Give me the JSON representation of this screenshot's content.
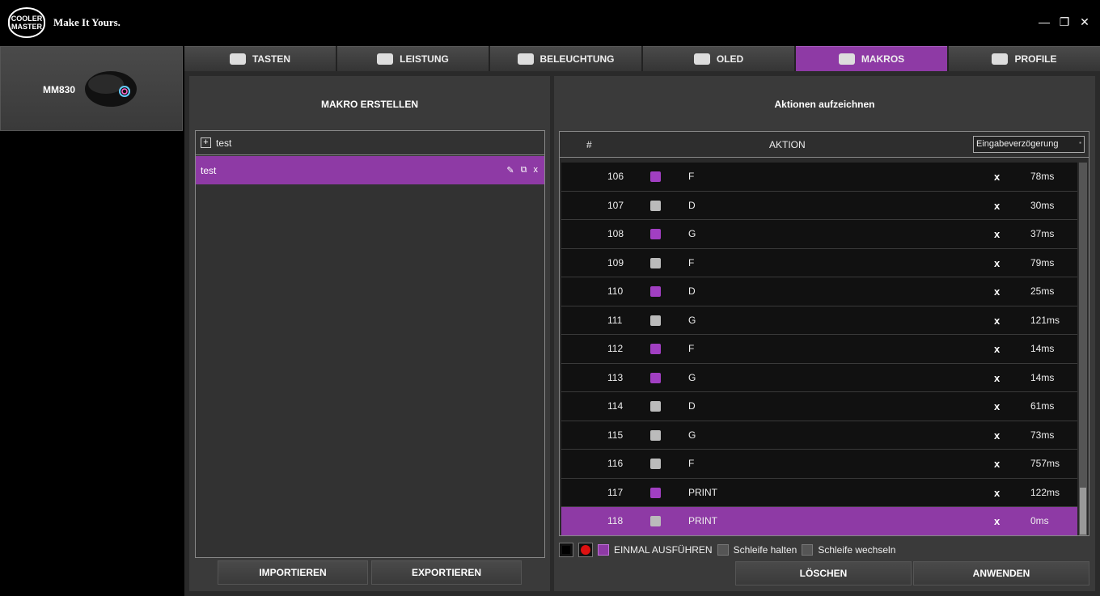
{
  "header": {
    "logo": "COOLER MASTER",
    "tagline": "Make It Yours."
  },
  "window": {
    "minimize": "—",
    "maximize": "❐",
    "close": "✕"
  },
  "device": {
    "name": "MM830"
  },
  "tabs": [
    {
      "label": "TASTEN",
      "icon": "keyboard-icon"
    },
    {
      "label": "LEISTUNG",
      "icon": "speedometer-icon"
    },
    {
      "label": "BELEUCHTUNG",
      "icon": "lightbulb-icon"
    },
    {
      "label": "OLED",
      "icon": "oled-icon"
    },
    {
      "label": "MAKROS",
      "icon": "macro-icon",
      "active": true
    },
    {
      "label": "PROFILE",
      "icon": "profile-icon"
    }
  ],
  "left": {
    "title": "MAKRO ERSTELLEN",
    "group": "test",
    "macro": "test",
    "actions": {
      "edit": "✎",
      "copy": "⧉",
      "delete": "x"
    },
    "import": "IMPORTIEREN",
    "export": "EXPORTIEREN"
  },
  "right": {
    "title": "Aktionen aufzeichnen",
    "col_num": "#",
    "col_action": "AKTION",
    "delay_select": "Eingabeverzögerung",
    "rows": [
      {
        "n": "106",
        "type": "down",
        "key": "F",
        "delay": "78ms"
      },
      {
        "n": "107",
        "type": "up",
        "key": "D",
        "delay": "30ms"
      },
      {
        "n": "108",
        "type": "down",
        "key": "G",
        "delay": "37ms"
      },
      {
        "n": "109",
        "type": "up",
        "key": "F",
        "delay": "79ms"
      },
      {
        "n": "110",
        "type": "down",
        "key": "D",
        "delay": "25ms"
      },
      {
        "n": "111",
        "type": "up",
        "key": "G",
        "delay": "121ms"
      },
      {
        "n": "112",
        "type": "down",
        "key": "F",
        "delay": "14ms"
      },
      {
        "n": "113",
        "type": "down",
        "key": "G",
        "delay": "14ms"
      },
      {
        "n": "114",
        "type": "up",
        "key": "D",
        "delay": "61ms"
      },
      {
        "n": "115",
        "type": "up",
        "key": "G",
        "delay": "73ms"
      },
      {
        "n": "116",
        "type": "up",
        "key": "F",
        "delay": "757ms"
      },
      {
        "n": "117",
        "type": "down",
        "key": "PRINT",
        "delay": "122ms"
      },
      {
        "n": "118",
        "type": "up",
        "key": "PRINT",
        "delay": "0ms",
        "selected": true
      }
    ],
    "options": {
      "once": "EINMAL AUSFÜHREN",
      "hold": "Schleife halten",
      "toggle": "Schleife wechseln"
    },
    "delete": "LÖSCHEN",
    "apply": "ANWENDEN"
  },
  "colors": {
    "accent": "#8e3aa5",
    "bg": "#3a3a3a"
  }
}
